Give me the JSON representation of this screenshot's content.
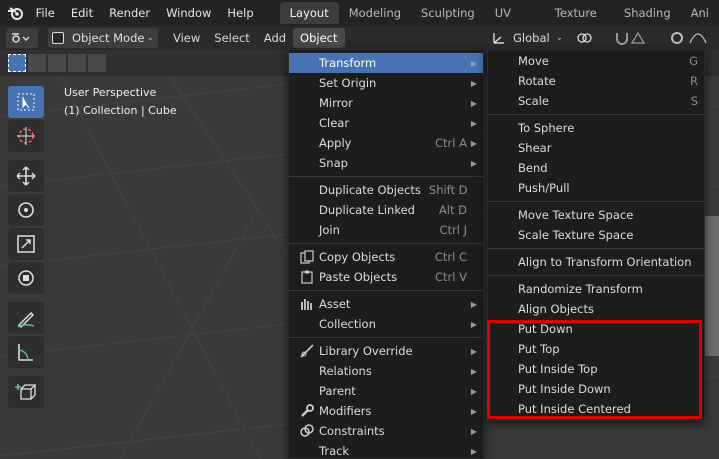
{
  "topbar": {
    "menus": [
      "File",
      "Edit",
      "Render",
      "Window",
      "Help"
    ],
    "tabs": [
      "Layout",
      "Modeling",
      "Sculpting",
      "UV Editing",
      "Texture Paint",
      "Shading",
      "Ani"
    ],
    "active_tab": "Layout"
  },
  "header": {
    "mode": "Object Mode",
    "menus": [
      "View",
      "Select",
      "Add",
      "Object"
    ],
    "transform_orientation": "Global"
  },
  "viewport": {
    "perspective": "User Perspective",
    "collection": "(1) Collection | Cube"
  },
  "object_menu": {
    "items": [
      {
        "label": "Transform",
        "shortcut": "",
        "submenu": true
      },
      {
        "label": "Set Origin",
        "shortcut": "",
        "submenu": true
      },
      {
        "label": "Mirror",
        "shortcut": "",
        "submenu": true
      },
      {
        "label": "Clear",
        "shortcut": "",
        "submenu": true
      },
      {
        "label": "Apply",
        "shortcut": "Ctrl A",
        "submenu": true
      },
      {
        "label": "Snap",
        "shortcut": "",
        "submenu": true
      },
      {
        "label": "Duplicate Objects",
        "shortcut": "Shift D",
        "submenu": false
      },
      {
        "label": "Duplicate Linked",
        "shortcut": "Alt D",
        "submenu": false
      },
      {
        "label": "Join",
        "shortcut": "Ctrl J",
        "submenu": false
      },
      {
        "label": "Copy Objects",
        "shortcut": "Ctrl C",
        "submenu": false
      },
      {
        "label": "Paste Objects",
        "shortcut": "Ctrl V",
        "submenu": false
      },
      {
        "label": "Asset",
        "shortcut": "",
        "submenu": true
      },
      {
        "label": "Collection",
        "shortcut": "",
        "submenu": true
      },
      {
        "label": "Library Override",
        "shortcut": "",
        "submenu": true
      },
      {
        "label": "Relations",
        "shortcut": "",
        "submenu": true
      },
      {
        "label": "Parent",
        "shortcut": "",
        "submenu": true
      },
      {
        "label": "Modifiers",
        "shortcut": "",
        "submenu": true
      },
      {
        "label": "Constraints",
        "shortcut": "",
        "submenu": true
      },
      {
        "label": "Track",
        "shortcut": "",
        "submenu": true
      }
    ]
  },
  "transform_menu": {
    "items": [
      {
        "label": "Move",
        "shortcut": "G"
      },
      {
        "label": "Rotate",
        "shortcut": "R"
      },
      {
        "label": "Scale",
        "shortcut": "S"
      },
      {
        "label": "To Sphere",
        "shortcut": ""
      },
      {
        "label": "Shear",
        "shortcut": ""
      },
      {
        "label": "Bend",
        "shortcut": ""
      },
      {
        "label": "Push/Pull",
        "shortcut": ""
      },
      {
        "label": "Move Texture Space",
        "shortcut": ""
      },
      {
        "label": "Scale Texture Space",
        "shortcut": ""
      },
      {
        "label": "Align to Transform Orientation",
        "shortcut": ""
      },
      {
        "label": "Randomize Transform",
        "shortcut": ""
      },
      {
        "label": "Align Objects",
        "shortcut": ""
      },
      {
        "label": "Put Down",
        "shortcut": ""
      },
      {
        "label": "Put Top",
        "shortcut": ""
      },
      {
        "label": "Put Inside Top",
        "shortcut": ""
      },
      {
        "label": "Put Inside Down",
        "shortcut": ""
      },
      {
        "label": "Put Inside Centered",
        "shortcut": ""
      }
    ]
  },
  "colors": {
    "highlight": "#4772b3",
    "annotation": "#e00000"
  }
}
